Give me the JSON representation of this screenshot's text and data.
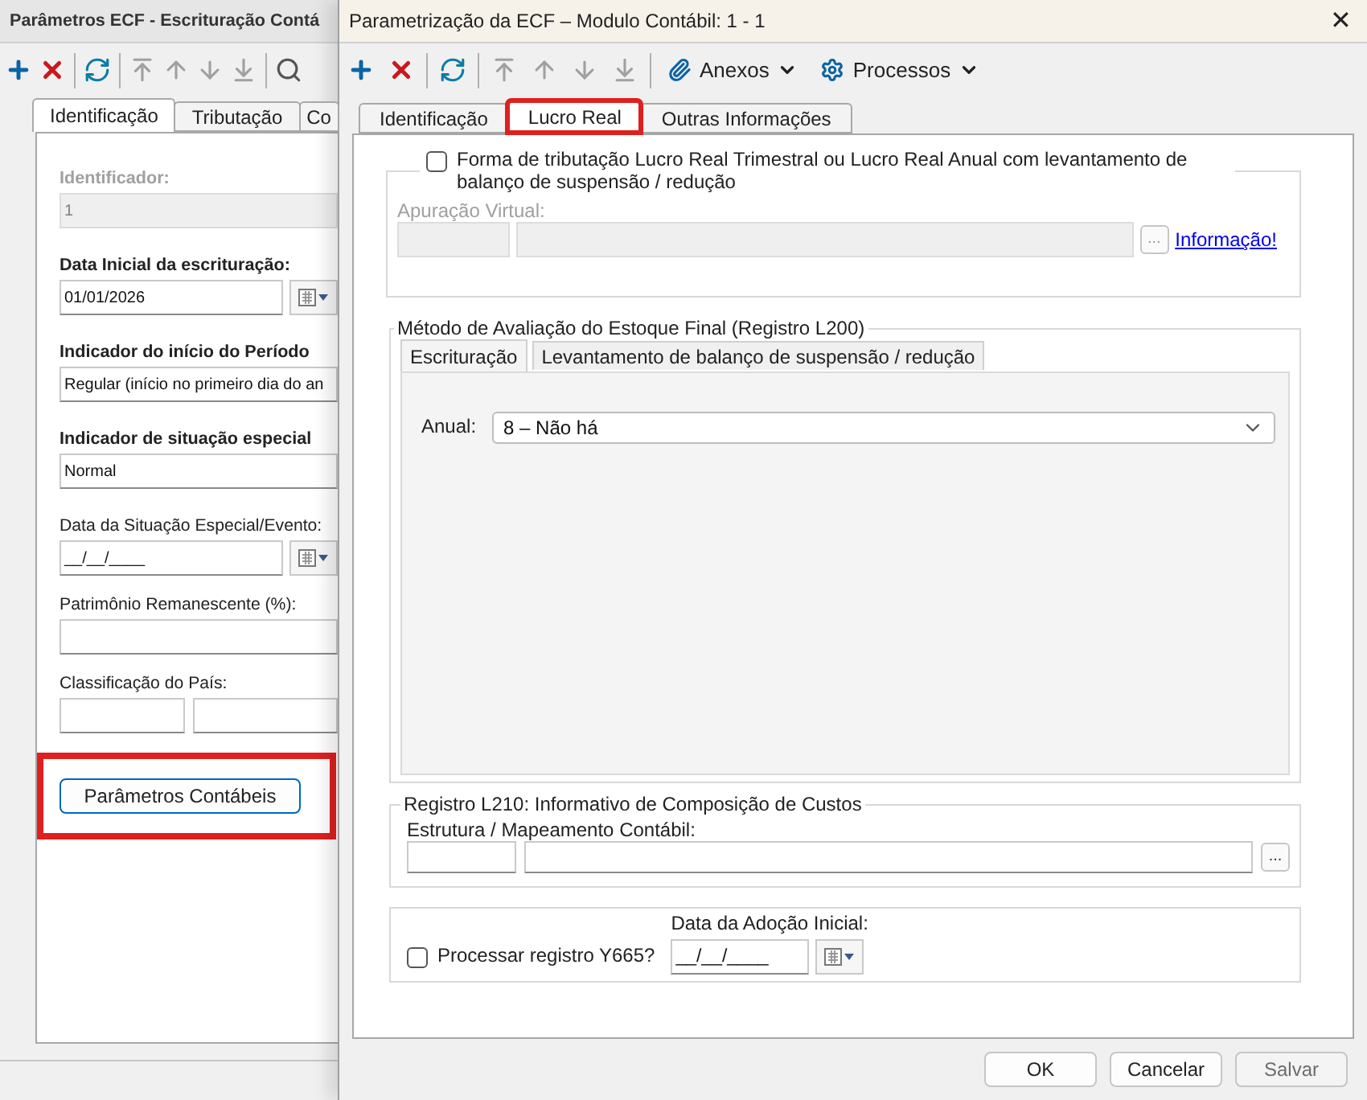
{
  "back_window": {
    "title": "Parâmetros ECF - Escrituração Contá",
    "toolbar": [
      {
        "kind": "add",
        "disabled": false
      },
      {
        "kind": "delete",
        "disabled": false
      },
      {
        "kind": "refresh",
        "disabled": false
      },
      {
        "kind": "first",
        "disabled": true
      },
      {
        "kind": "up",
        "disabled": true
      },
      {
        "kind": "down",
        "disabled": true
      },
      {
        "kind": "last",
        "disabled": true
      },
      {
        "kind": "search",
        "disabled": false
      }
    ],
    "tabs": [
      {
        "label": "Identificação",
        "selected": true
      },
      {
        "label": "Tributação",
        "selected": false
      },
      {
        "label": "Co",
        "selected": false
      }
    ],
    "fields": [
      {
        "kind": "text",
        "label": "Identificador:",
        "bold": true,
        "disabled": true,
        "value": "1"
      },
      {
        "kind": "date",
        "label": "Data Inicial da escrituração:",
        "bold": true,
        "disabled": false,
        "value": "01/01/2026"
      },
      {
        "kind": "text",
        "label": "Indicador do início do Período",
        "bold": true,
        "disabled": false,
        "value": "Regular (início no primeiro dia do an"
      },
      {
        "kind": "text",
        "label": "Indicador de situação especial",
        "bold": true,
        "disabled": false,
        "value": "Normal"
      },
      {
        "kind": "date",
        "label": "Data da Situação Especial/Evento:",
        "bold": false,
        "disabled": false,
        "value": "__/__/____"
      },
      {
        "kind": "text",
        "label": "Patrimônio Remanescente (%):",
        "bold": false,
        "disabled": false
      },
      {
        "kind": "pair",
        "label": "Classificação do País:",
        "bold": false,
        "disabled": false
      }
    ],
    "button": {
      "label": "Parâmetros Contábeis",
      "highlighted": true
    }
  },
  "dialog": {
    "title": "Parametrização da ECF – Modulo Contábil: 1 - 1",
    "close": "✕",
    "toolbar": [
      {
        "kind": "add",
        "disabled": false
      },
      {
        "kind": "delete",
        "disabled": false
      },
      {
        "kind": "refresh",
        "disabled": false
      },
      {
        "kind": "first",
        "disabled": true
      },
      {
        "kind": "up",
        "disabled": true
      },
      {
        "kind": "down",
        "disabled": true
      },
      {
        "kind": "last",
        "disabled": true
      }
    ],
    "menus": [
      {
        "kind": "attach",
        "label": "Anexos"
      },
      {
        "kind": "gear",
        "label": "Processos"
      }
    ],
    "tabs": [
      {
        "label": "Identificação",
        "selected": false,
        "highlighted": false
      },
      {
        "label": "Lucro Real",
        "selected": true,
        "highlighted": true
      },
      {
        "label": "Outras Informações",
        "selected": false,
        "highlighted": false
      }
    ],
    "suspension": {
      "checkbox": {
        "label": "Forma de tributação Lucro Real Trimestral ou Lucro Real Anual com levantamento de balanço de suspensão / redução",
        "checked": false
      },
      "field_label": "Apuração Virtual:",
      "browse": "...",
      "disabled": true,
      "link": "Informação!"
    },
    "stock": {
      "title": "Método de Avaliação do Estoque Final (Registro L200)",
      "tabs": [
        {
          "label": "Escrituração",
          "selected": true
        },
        {
          "label": "Levantamento de balanço de suspensão / redução",
          "selected": false
        }
      ],
      "select_label": "Anual:",
      "select_value": "8 – Não há"
    },
    "costs": {
      "title": "Registro L210: Informativo de Composição de Custos",
      "field_label": "Estrutura / Mapeamento Contábil:",
      "browse": "..."
    },
    "y665": {
      "checkbox": {
        "label": "Processar registro Y665?",
        "checked": false
      },
      "date_label": "Data da Adoção Inicial:",
      "date_value": "__/__/____"
    },
    "buttons": [
      {
        "label": "OK",
        "disabled": false
      },
      {
        "label": "Cancelar",
        "disabled": false
      },
      {
        "label": "Salvar",
        "disabled": true
      }
    ]
  }
}
